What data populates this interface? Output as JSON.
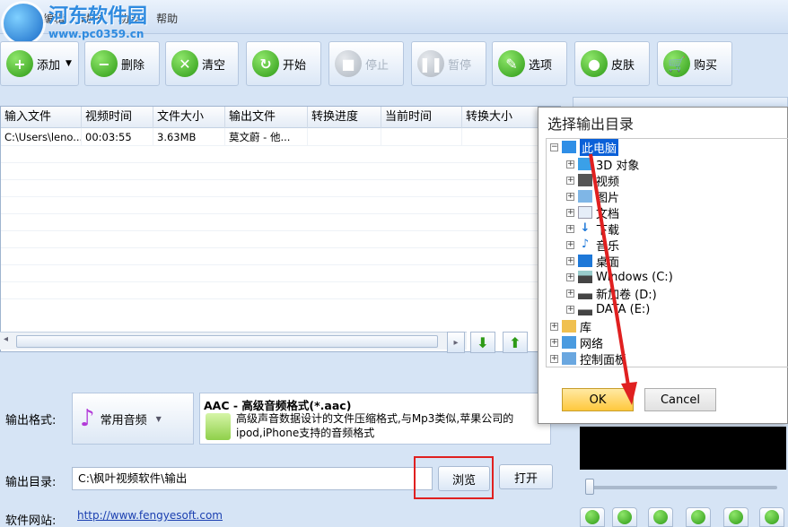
{
  "menu": {
    "items": [
      "文件",
      "编辑",
      "动作",
      "功能",
      "帮助"
    ]
  },
  "watermark": {
    "title": "河东软件园",
    "url": "www.pc0359.cn"
  },
  "toolbar": {
    "add": "添加",
    "delete": "删除",
    "clear": "清空",
    "start": "开始",
    "stop": "停止",
    "pause": "暂停",
    "options": "选项",
    "skin": "皮肤",
    "buy": "购买"
  },
  "table": {
    "headers": [
      "输入文件",
      "视频时间",
      "文件大小",
      "输出文件",
      "转换进度",
      "当前时间",
      "转换大小"
    ],
    "rows": [
      [
        "C:\\Users\\leno...",
        "00:03:55",
        "3.63MB",
        "莫文蔚 - 他...",
        "",
        "",
        ""
      ]
    ]
  },
  "output": {
    "format_label": "输出格式:",
    "format_value": "常用音频",
    "format_title": "AAC - 高级音频格式(*.aac)",
    "format_desc": "高级声音数据设计的文件压缩格式,与Mp3类似,苹果公司的ipod,iPhone支持的音频格式",
    "dir_label": "输出目录:",
    "dir_value": "C:\\枫叶视频软件\\输出",
    "browse": "浏览",
    "open": "打开",
    "site_label": "软件网站:",
    "site_url": "http://www.fengyesoft.com"
  },
  "dialog": {
    "title": "选择输出目录",
    "tree": {
      "root": "此电脑",
      "children": [
        "3D 对象",
        "视频",
        "图片",
        "文档",
        "下载",
        "音乐",
        "桌面",
        "Windows (C:)",
        "新加卷 (D:)",
        "DATA (E:)"
      ],
      "others": [
        "库",
        "网络",
        "控制面板"
      ]
    },
    "ok": "OK",
    "cancel": "Cancel"
  },
  "colors": {
    "accent": "#0a60d8",
    "highlight": "#e02020",
    "ok_button": "#ffc83d"
  },
  "icons": {
    "add": "plus-icon",
    "delete": "minus-icon",
    "clear": "x-icon",
    "start": "refresh-icon",
    "stop": "stop-icon",
    "pause": "pause-icon",
    "options": "wrench-icon",
    "skin": "apple-icon",
    "buy": "cart-icon"
  }
}
